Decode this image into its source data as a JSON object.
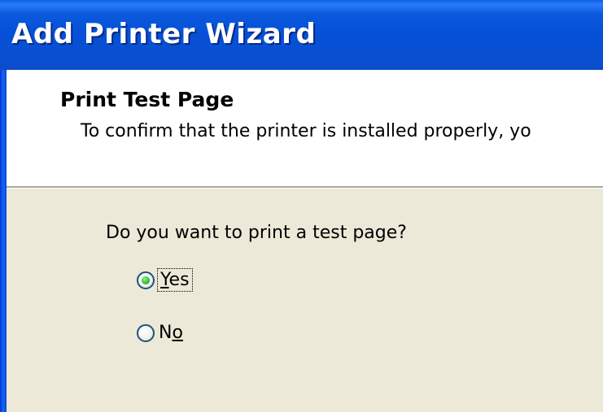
{
  "window": {
    "title": "Add Printer Wizard"
  },
  "header": {
    "title": "Print Test Page",
    "subtitle": "To confirm that the printer is installed properly, yo"
  },
  "body": {
    "question": "Do you want to print a test page?",
    "options": [
      {
        "label_mnemonic": "Y",
        "label_rest": "es",
        "selected": true
      },
      {
        "label_pre": "N",
        "label_mnemonic": "o",
        "selected": false
      }
    ]
  },
  "colors": {
    "titlebar": "#0550d6",
    "dialog_background": "#ece9d8",
    "header_background": "#ffffff",
    "radio_selected_dot": "#3cbf3c",
    "radio_border": "#1c5180"
  }
}
